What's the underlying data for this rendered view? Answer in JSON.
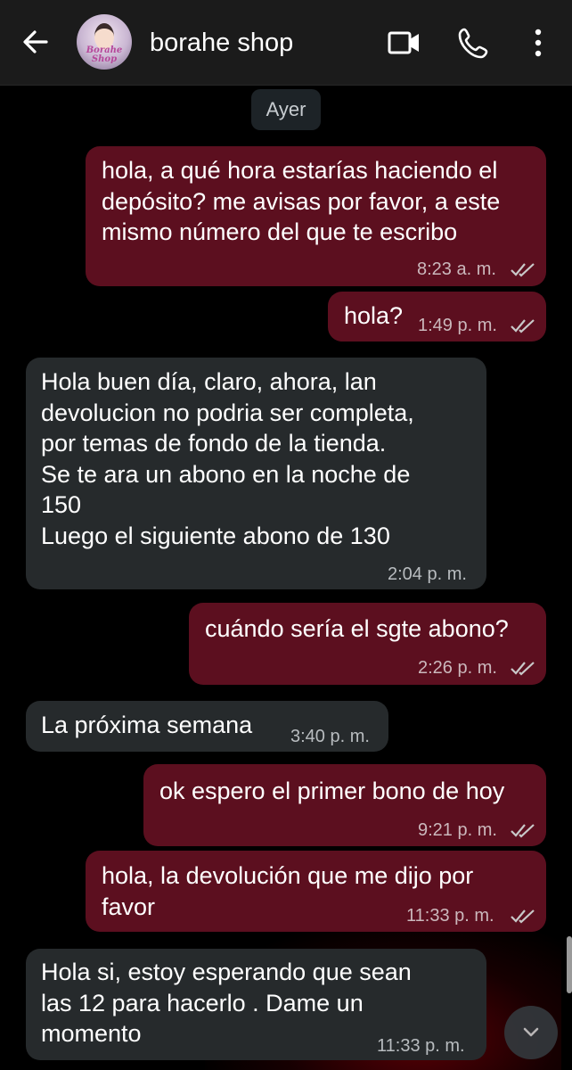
{
  "header": {
    "contact_name": "borahe shop",
    "avatar_text": "Borahe Shop",
    "icons": [
      "back-arrow-icon",
      "video-call-icon",
      "phone-icon",
      "more-vertical-icon"
    ]
  },
  "chat": {
    "date_label": "Ayer",
    "messages": [
      {
        "direction": "outgoing",
        "text": "hola, a qué hora estarías haciendo el\ndepósito? me avisas por favor, a este\nmismo número del que te escribo",
        "time": "8:23 a. m.",
        "status": "read"
      },
      {
        "direction": "outgoing",
        "text": "hola?",
        "time": "1:49 p. m.",
        "status": "read"
      },
      {
        "direction": "incoming",
        "text": "Hola buen día, claro, ahora, lan\ndevolucion no podria ser completa,\npor temas de fondo de la tienda.\nSe te ara un abono en la noche de\n150\nLuego el siguiente abono de 130",
        "time": "2:04 p. m."
      },
      {
        "direction": "outgoing",
        "text": "cuándo sería el sgte abono?",
        "time": "2:26 p. m.",
        "status": "read"
      },
      {
        "direction": "incoming",
        "text": "La próxima semana",
        "time": "3:40 p. m."
      },
      {
        "direction": "outgoing",
        "text": "ok espero el primer bono de hoy",
        "time": "9:21 p. m.",
        "status": "read"
      },
      {
        "direction": "outgoing",
        "text": "hola, la devolución que me dijo por\nfavor",
        "time": "11:33 p. m.",
        "status": "read"
      },
      {
        "direction": "incoming",
        "text": "Hola si, estoy esperando que sean\nlas 12 para hacerlo . Dame un\nmomento",
        "time": "11:33 p. m."
      }
    ]
  },
  "colors": {
    "outgoing_bubble": "#5c0f1f",
    "incoming_bubble": "#262a2c",
    "read_ticks": "#c9c9c9"
  }
}
